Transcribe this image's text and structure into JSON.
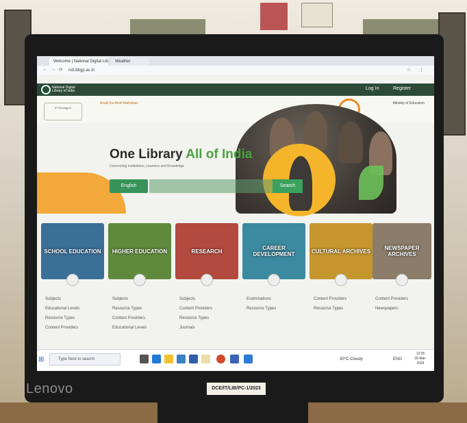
{
  "browser": {
    "tab1": "Welcome | National Digital Library of India",
    "tab2": "Weather",
    "address": "ndl.iitkgp.ac.in"
  },
  "site": {
    "brand": "National Digital Library of India",
    "login": "Log In",
    "register": "Register",
    "partner_iit": "IIT Kharagpur",
    "partner_azadi": "Azadi Ka Amrit Mahotsav",
    "partner_digital_india": "Digital India",
    "partner_ministry": "Ministry of Education",
    "hero_title_part1": "One Library",
    "hero_title_part2": "All of India",
    "hero_subtitle": "Connecting Institutions, Learners and Knowledge",
    "language_button": "English",
    "search_placeholder": "Search",
    "search_button": "Search"
  },
  "categories": [
    {
      "label": "SCHOOL EDUCATION",
      "color": "#3a6f98",
      "links": [
        "Subjects",
        "Educational Levels",
        "Resource Types",
        "Content Providers"
      ]
    },
    {
      "label": "HIGHER EDUCATION",
      "color": "#5f8a3d",
      "links": [
        "Subjects",
        "Resource Types",
        "Content Providers",
        "Educational Levels"
      ]
    },
    {
      "label": "RESEARCH",
      "color": "#b24a3f",
      "links": [
        "Subjects",
        "Content Providers",
        "Resource Types",
        "Journals"
      ]
    },
    {
      "label": "CAREER DEVELOPMENT",
      "color": "#3b8aa0",
      "links": [
        "Examinations",
        "Resource Types"
      ]
    },
    {
      "label": "CULTURAL ARCHIVES",
      "color": "#c4962d",
      "links": [
        "Content Providers",
        "Resource Types"
      ]
    },
    {
      "label": "NEWSPAPER ARCHIVES",
      "color": "#8b7d6a",
      "links": [
        "Content Providers",
        "Newspapers"
      ]
    }
  ],
  "taskbar": {
    "search_placeholder": "Type here to search",
    "weather": "30°C Cloudy",
    "language": "ENG",
    "time": "12:05",
    "date": "20-Mar-2024"
  },
  "monitor": {
    "brand": "Lenovo",
    "asset_tag": "DCE/IT/LIB/PC-1/2023"
  },
  "colors": {
    "header_green": "#2b4a37",
    "accent_green": "#4aa43f",
    "accent_orange": "#f2a83a"
  }
}
